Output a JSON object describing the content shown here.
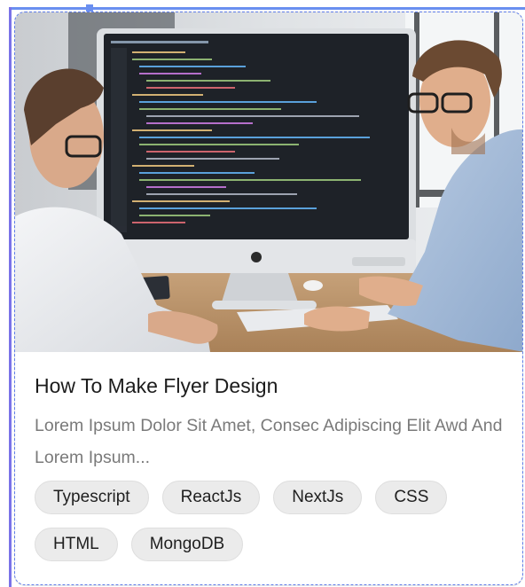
{
  "card": {
    "image": "Two developers looking at a computer monitor displaying code",
    "title": "How To Make Flyer Design",
    "description": "Lorem Ipsum Dolor Sit Amet, Consec Adipiscing Elit Awd And Lorem Ipsum...",
    "tags": [
      "Typescript",
      "ReactJs",
      "NextJs",
      "CSS",
      "HTML",
      "MongoDB"
    ]
  }
}
